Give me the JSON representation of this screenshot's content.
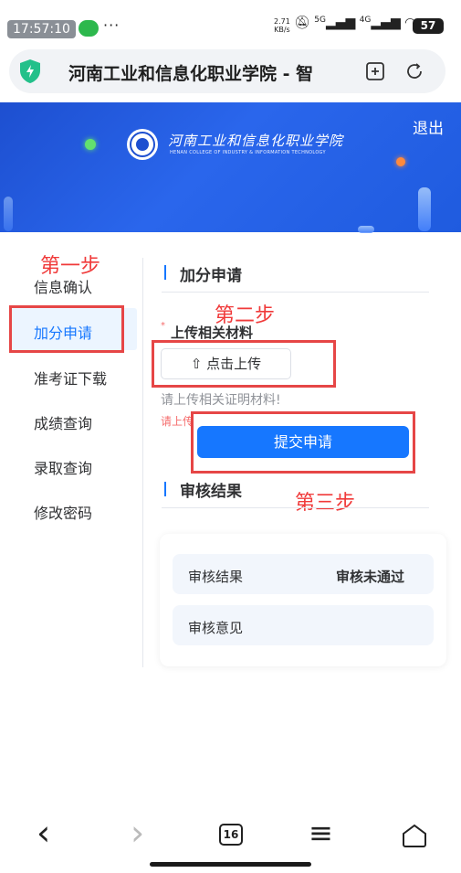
{
  "status_bar": {
    "time_badge": "17:57:10",
    "more": "···",
    "net_speed_value": "2.71",
    "net_speed_unit": "KB/s",
    "signal_1": "5G",
    "signal_2": "4G",
    "battery": "57"
  },
  "browser": {
    "page_title": "河南工业和信息化职业学院 - 智"
  },
  "banner": {
    "logout_label": "退出",
    "college_name": "河南工业和信息化职业学院",
    "college_name_en": "HENAN COLLEGE OF INDUSTRY & INFORMATION TECHNOLOGY"
  },
  "sidebar": {
    "items": [
      {
        "label": "信息确认"
      },
      {
        "label": "加分申请",
        "active": true
      },
      {
        "label": "准考证下载"
      },
      {
        "label": "成绩查询"
      },
      {
        "label": "录取查询"
      },
      {
        "label": "修改密码"
      }
    ]
  },
  "main": {
    "section1_title": "加分申请",
    "required_mark": "*",
    "upload_label": "上传相关材料",
    "upload_button_label": "点击上传",
    "upload_hint": "请上传相关证明材料!",
    "upload_error": "请上传",
    "submit_label": "提交申请",
    "section2_title": "审核结果",
    "result_rows": [
      {
        "label": "审核结果",
        "value": "审核未通过"
      },
      {
        "label": "审核意见",
        "value": ""
      }
    ]
  },
  "annotations": {
    "step1": "第一步",
    "step2": "第二步",
    "step3": "第三步"
  },
  "bottom_nav": {
    "back": "‹",
    "forward": "›",
    "tab_count": "16",
    "menu": "≡"
  },
  "colors": {
    "accent": "#1677ff",
    "annotation": "#e64646",
    "banner": "#2a66ec"
  }
}
